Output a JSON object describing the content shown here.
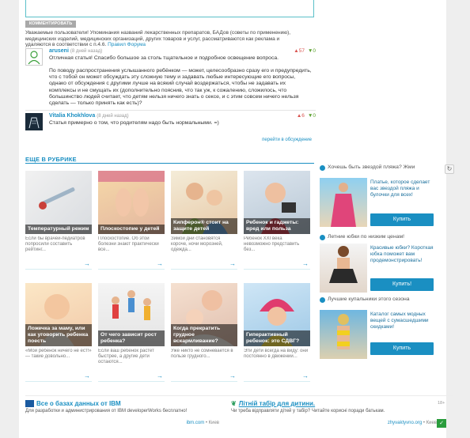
{
  "comment_form": {
    "button_label": "КОММЕНТИРОВАТЬ"
  },
  "warning": {
    "text": "Уважаемые пользователи! Упоминания названий лекарственных препаратов, БАДов (советы по применению), медицинских изделий, медицинских организаций, других товаров и услуг, рассматриваются как реклама и удаляются в соответствии с п.4.6.",
    "link": "Правил Форума"
  },
  "comments": [
    {
      "author": "aruseni",
      "time": "(8 дней назад)",
      "up": "▲57",
      "down": "▼0",
      "text1": "Отличная статья! Спасибо большое за столь тщательное и подробное освещение вопроса.",
      "text2": "По поводу распространения услышанного ребёнком — может, целесообразно сразу его и предупредить, что с тобой он может обсуждать эту сложную тему и задавать любые интересующие его вопросы, однако от обсуждения с другими лучше на всякий случай воздержаться, чтобы не задавать их комплексы и не смущать их (дополнительно пояснив, что так уж, к сожалению, сложилось, что большинство людей считает, что детям нельзя ничего знать о сексе, и с этим совсем ничего нельзя сделать — только принять как есть)?"
    },
    {
      "author": "Vitalia Khokhlova",
      "time": "(8 дней назад)",
      "up": "▲6",
      "down": "▼0",
      "text1": "Статья примерно о том, что родителям надо быть нормальными. =)"
    }
  ],
  "reply_link": "перейти в обсуждение",
  "section": {
    "title": "ЕЩЕ В РУБРИКЕ"
  },
  "cards": [
    {
      "caption": "Температурный режим",
      "desc": "Если бы врачей-педиатров попросили составить рейтинг...",
      "arrow": "→"
    },
    {
      "caption": "Плоскостопие у детей",
      "desc": "Плоскостопие. Об этой болезни знают практически все...",
      "arrow": "→"
    },
    {
      "caption": "Кипферон® стоит на защите детей",
      "desc": "Зимой дни становятся короче, ночи морозней, одежда...",
      "arrow": "→"
    },
    {
      "caption": "Ребенок и гаджеты: вред или польза",
      "desc": "Ребенок XXI века невозможно представить без...",
      "arrow": "→"
    },
    {
      "caption": "Ложечка за маму, или как уговорить ребенка поесть",
      "desc": "«Мой ребенок ничего не ест!» — такие довольно...",
      "arrow": "→"
    },
    {
      "caption": "От чего зависит рост ребенка?",
      "desc": "Если ваш ребенок растет быстрее, а другие дети остаются...",
      "arrow": "→"
    },
    {
      "caption": "Когда прекратить грудное вскармливание?",
      "desc": "Уже никто не сомневается в пользе грудного...",
      "arrow": "→"
    },
    {
      "caption": "Гиперактивный ребенок: это СДВГ?",
      "desc": "Эти дети всегда на виду: они постоянно в движении...",
      "arrow": "→"
    }
  ],
  "ads": [
    {
      "title": "Хочешь быть звездой пляжа? Жми",
      "text": "Платье, которое сделает вас звездой пляжа и булочки для всех!",
      "button": "Купить"
    },
    {
      "title": "Летние юбки по низким ценам!",
      "text": "Красивые юбки? Короткая юбка поможет вам продемонстрировать!",
      "button": "Купить!"
    },
    {
      "title": "Лучшие купальники этого сезона",
      "text": "Каталог самых модных вещей с сумасшедшими скидками!",
      "button": "Купить"
    }
  ],
  "refresh_icon": "↻",
  "promos": [
    {
      "title": "Все о базах данных от IBM",
      "text": "Для разработки и администрирования от IBM developerWorks бесплатно!",
      "source": "ibm.com",
      "city": "Киев"
    },
    {
      "title": "Літній табір для дитини.",
      "text": "Чи треба відправляти дітей у табір? Читайте корисні поради батькам.",
      "source": "zhyvaktyvno.org",
      "city": "Киев"
    }
  ],
  "age_badge": "18+",
  "colors": {
    "accent": "#1a8fc2",
    "border": "#5bc0c9",
    "buy": "#1a8fc2"
  }
}
